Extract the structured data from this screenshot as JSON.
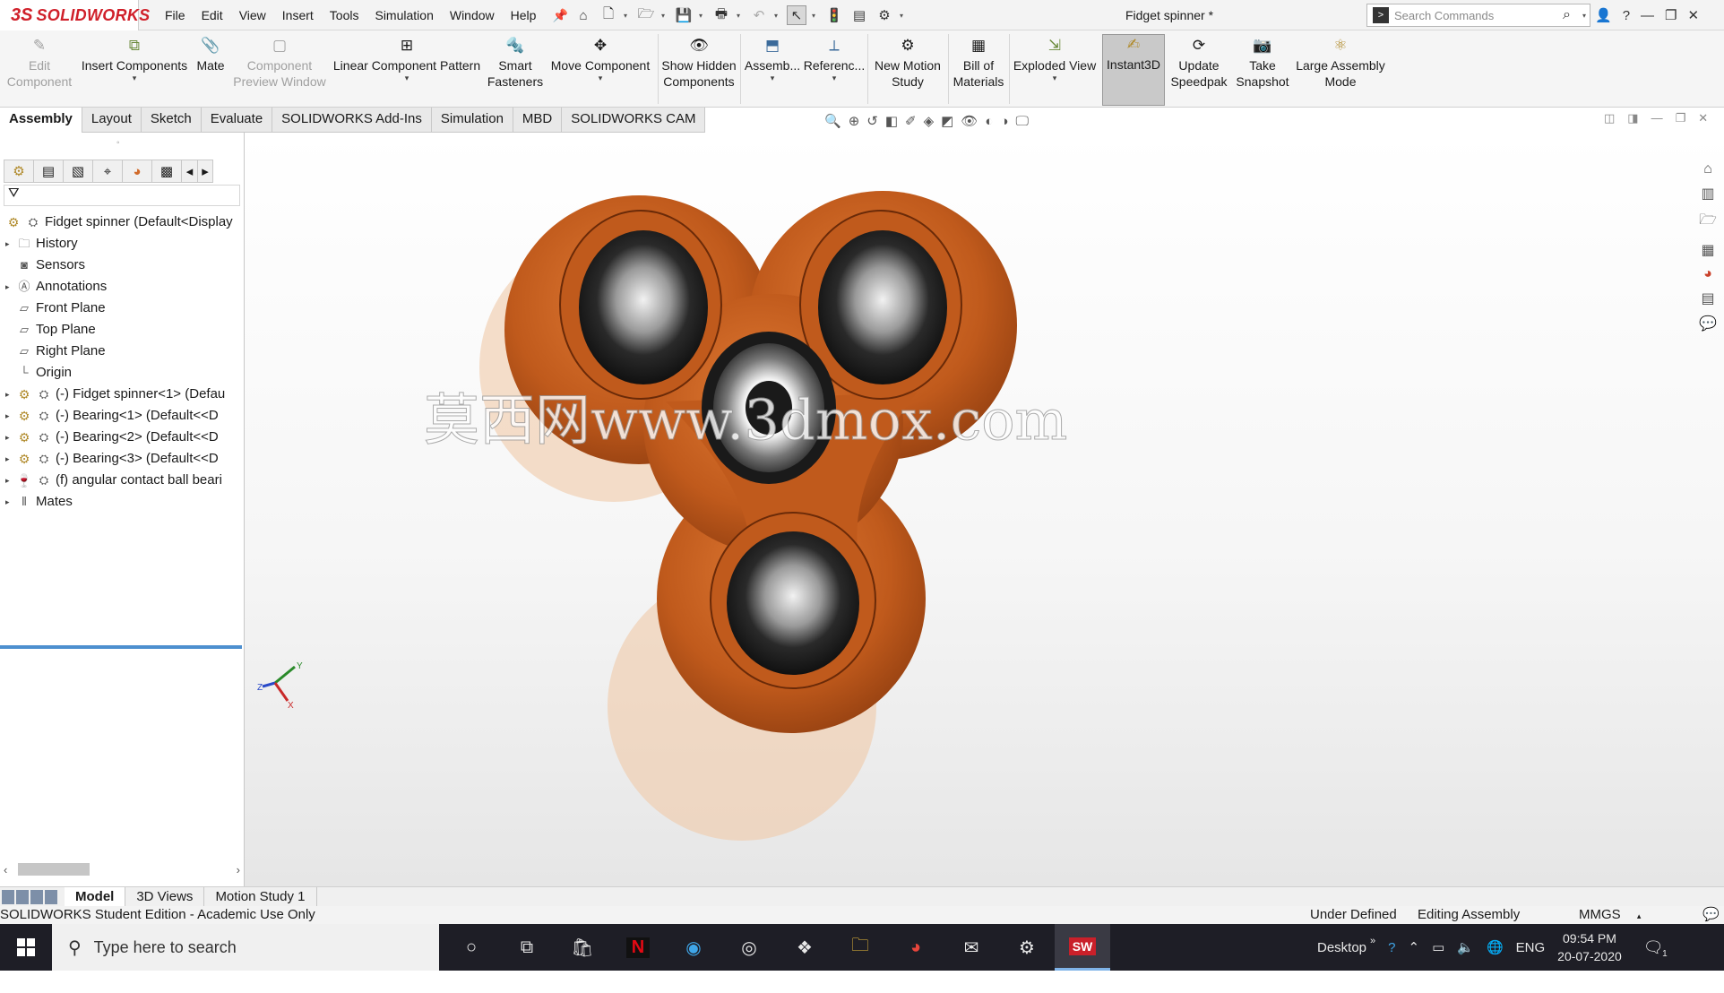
{
  "app": {
    "brand": "SOLIDWORKS",
    "logo_mark": "3S",
    "document_title": "Fidget spinner *",
    "colors": {
      "accent": "#d0202a",
      "part": "#c05a1c",
      "selection_line": "#4d8fcf",
      "taskbar": "#1e1e26"
    }
  },
  "menu": [
    "File",
    "Edit",
    "View",
    "Insert",
    "Tools",
    "Simulation",
    "Window",
    "Help"
  ],
  "search": {
    "placeholder": "Search Commands"
  },
  "commands": [
    {
      "line1": "Edit",
      "line2": "Component",
      "disabled": true
    },
    {
      "line1": "Insert Components",
      "line2": "",
      "disabled": false
    },
    {
      "line1": "Mate",
      "line2": "",
      "disabled": false
    },
    {
      "line1": "Component",
      "line2": "Preview Window",
      "disabled": true
    },
    {
      "line1": "Linear Component Pattern",
      "line2": "",
      "disabled": false
    },
    {
      "line1": "Smart",
      "line2": "Fasteners",
      "disabled": false
    },
    {
      "line1": "Move Component",
      "line2": "",
      "disabled": false
    },
    {
      "line1": "Show Hidden",
      "line2": "Components",
      "disabled": false
    },
    {
      "line1": "Assemb...",
      "line2": "",
      "disabled": false
    },
    {
      "line1": "Referenc...",
      "line2": "",
      "disabled": false
    },
    {
      "line1": "New Motion",
      "line2": "Study",
      "disabled": false
    },
    {
      "line1": "Bill of",
      "line2": "Materials",
      "disabled": false
    },
    {
      "line1": "Exploded View",
      "line2": "",
      "disabled": false
    },
    {
      "line1": "Instant3D",
      "line2": "",
      "disabled": false
    },
    {
      "line1": "Update",
      "line2": "Speedpak",
      "disabled": false
    },
    {
      "line1": "Take",
      "line2": "Snapshot",
      "disabled": false
    },
    {
      "line1": "Large Assembly",
      "line2": "Mode",
      "disabled": false
    }
  ],
  "tabs": [
    "Assembly",
    "Layout",
    "Sketch",
    "Evaluate",
    "SOLIDWORKS Add-Ins",
    "Simulation",
    "MBD",
    "SOLIDWORKS CAM"
  ],
  "tree": {
    "root": "Fidget spinner  (Default<Display",
    "items": [
      {
        "label": "History",
        "expandable": true
      },
      {
        "label": "Sensors",
        "expandable": false
      },
      {
        "label": "Annotations",
        "expandable": true
      },
      {
        "label": "Front Plane",
        "expandable": false
      },
      {
        "label": "Top Plane",
        "expandable": false
      },
      {
        "label": "Right Plane",
        "expandable": false
      },
      {
        "label": "Origin",
        "expandable": false
      },
      {
        "label": "(-) Fidget spinner<1> (Defau",
        "expandable": true
      },
      {
        "label": "(-) Bearing<1> (Default<<D",
        "expandable": true
      },
      {
        "label": "(-) Bearing<2> (Default<<D",
        "expandable": true
      },
      {
        "label": "(-) Bearing<3> (Default<<D",
        "expandable": true
      },
      {
        "label": "(f) angular contact ball beari",
        "expandable": true
      },
      {
        "label": "Mates",
        "expandable": true
      }
    ]
  },
  "viewport": {
    "watermark": "莫西网www.3dmox.com",
    "triad": {
      "x": "X",
      "y": "Y",
      "z": "Z"
    }
  },
  "bottom_tabs": [
    "Model",
    "3D Views",
    "Motion Study 1"
  ],
  "status": {
    "left": "SOLIDWORKS Student Edition - Academic Use Only",
    "under_defined": "Under Defined",
    "editing": "Editing Assembly",
    "units": "MMGS"
  },
  "taskbar": {
    "search_placeholder": "Type here to search",
    "desktop": "Desktop",
    "lang": "ENG",
    "time": "09:54 PM",
    "date": "20-07-2020",
    "notifications": "1"
  }
}
